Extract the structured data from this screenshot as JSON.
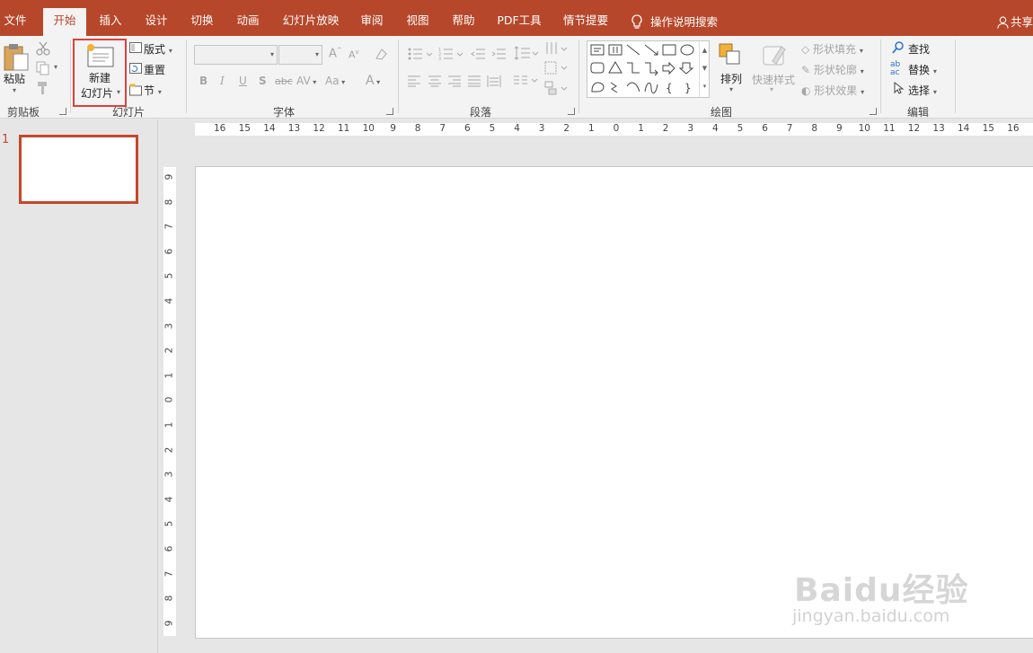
{
  "tabs": [
    {
      "label": "文件"
    },
    {
      "label": "开始"
    },
    {
      "label": "插入"
    },
    {
      "label": "设计"
    },
    {
      "label": "切换"
    },
    {
      "label": "动画"
    },
    {
      "label": "幻灯片放映"
    },
    {
      "label": "审阅"
    },
    {
      "label": "视图"
    },
    {
      "label": "帮助"
    },
    {
      "label": "PDF工具"
    },
    {
      "label": "情节提要"
    }
  ],
  "tell_me": "操作说明搜索",
  "share": "共享",
  "clipboard": {
    "paste": "粘贴",
    "group": "剪贴板"
  },
  "slides": {
    "new_line1": "新建",
    "new_line2": "幻灯片",
    "layout": "版式",
    "reset": "重置",
    "section": "节",
    "group": "幻灯片"
  },
  "font": {
    "group": "字体",
    "bold": "B",
    "italic": "I",
    "underline": "U",
    "shadow": "S",
    "strike": "abc",
    "spacing": "AV",
    "case": "Aa",
    "color": "A"
  },
  "paragraph": {
    "group": "段落"
  },
  "drawing": {
    "arrange": "排列",
    "quick_styles": "快速样式",
    "fill": "形状填充",
    "outline": "形状轮廓",
    "effects": "形状效果",
    "group": "绘图"
  },
  "editing": {
    "find": "查找",
    "replace": "替换",
    "select": "选择",
    "group": "编辑"
  },
  "slide_panel": {
    "number": "1"
  },
  "hruler": [
    "16",
    "15",
    "14",
    "13",
    "12",
    "11",
    "10",
    "9",
    "8",
    "7",
    "6",
    "5",
    "4",
    "3",
    "2",
    "1",
    "0",
    "1",
    "2",
    "3",
    "4",
    "5",
    "6",
    "7",
    "8",
    "9",
    "10",
    "11",
    "12",
    "13",
    "14",
    "15",
    "16"
  ],
  "vruler": [
    "9",
    "8",
    "7",
    "6",
    "5",
    "4",
    "3",
    "2",
    "1",
    "0",
    "1",
    "2",
    "3",
    "4",
    "5",
    "6",
    "7",
    "8",
    "9"
  ],
  "watermark": {
    "logo": "Baidu经验",
    "url": "jingyan.baidu.com"
  },
  "colors": {
    "accent": "#b7472a",
    "highlight": "#e0403a"
  }
}
